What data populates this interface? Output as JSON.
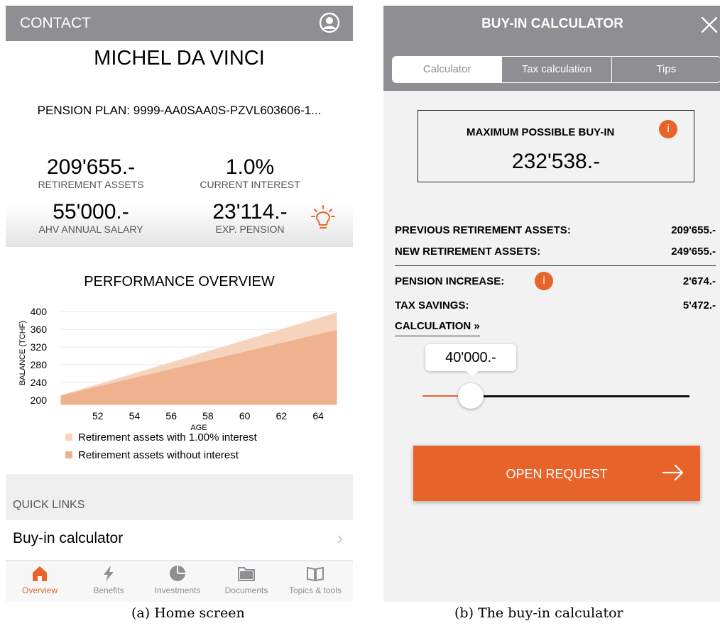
{
  "home": {
    "header_title": "CONTACT",
    "user_name": "MICHEL DA VINCI",
    "pension_plan": "PENSION PLAN: 9999-AA0SAA0S-PZVL603606-1...",
    "kpis": [
      {
        "value": "209'655.-",
        "label": "RETIREMENT ASSETS"
      },
      {
        "value": "1.0%",
        "label": "CURRENT INTEREST"
      },
      {
        "value": "55'000.-",
        "label": "AHV ANNUAL SALARY"
      },
      {
        "value": "23'114.-",
        "label": "EXP. PENSION"
      }
    ],
    "performance_title": "PERFORMANCE OVERVIEW",
    "quick_links_label": "QUICK LINKS",
    "quick_link_item": "Buy-in calculator",
    "tabs": [
      {
        "label": "Overview",
        "icon": "home-icon",
        "active": true
      },
      {
        "label": "Benefits",
        "icon": "bolt-icon",
        "active": false
      },
      {
        "label": "Investments",
        "icon": "pie-icon",
        "active": false
      },
      {
        "label": "Documents",
        "icon": "folder-icon",
        "active": false
      },
      {
        "label": "Topics & tools",
        "icon": "book-icon",
        "active": false
      }
    ],
    "accent_color": "#e8632a"
  },
  "chart_data": {
    "type": "area",
    "title": "PERFORMANCE OVERVIEW",
    "xlabel": "AGE",
    "ylabel": "BALANCE (TCHF)",
    "x_ticks": [
      52,
      54,
      56,
      58,
      60,
      62,
      64
    ],
    "y_ticks": [
      200,
      240,
      280,
      320,
      360,
      400
    ],
    "xlim": [
      50,
      65
    ],
    "ylim": [
      190,
      410
    ],
    "grid": true,
    "legend_position": "bottom",
    "series": [
      {
        "name": "Retirement assets with 1.00% interest",
        "color": "#f6d3bd",
        "x": [
          50,
          65
        ],
        "y": [
          210,
          397
        ]
      },
      {
        "name": "Retirement assets without interest",
        "color": "#f0b28e",
        "x": [
          50,
          65
        ],
        "y": [
          210,
          358
        ]
      }
    ]
  },
  "calculator": {
    "title": "BUY-IN CALCULATOR",
    "segments": [
      "Calculator",
      "Tax calculation",
      "Tips"
    ],
    "max_label": "MAXIMUM POSSIBLE BUY-IN",
    "max_value": "232'538.-",
    "info_glyph": "i",
    "rows": [
      {
        "label": "PREVIOUS RETIREMENT ASSETS:",
        "value": "209'655.-"
      },
      {
        "label": "NEW RETIREMENT ASSETS:",
        "value": "249'655.-"
      },
      {
        "label": "PENSION INCREASE:",
        "value": "2'674.-"
      },
      {
        "label": "TAX SAVINGS:",
        "value": "5'472.-"
      }
    ],
    "calculation_link": "CALCULATION »",
    "slider_value": "40'000.-",
    "slider_fraction": 0.18,
    "open_request": "OPEN REQUEST"
  },
  "captions": {
    "left": "(a) Home screen",
    "right": "(b) The buy-in calculator"
  }
}
